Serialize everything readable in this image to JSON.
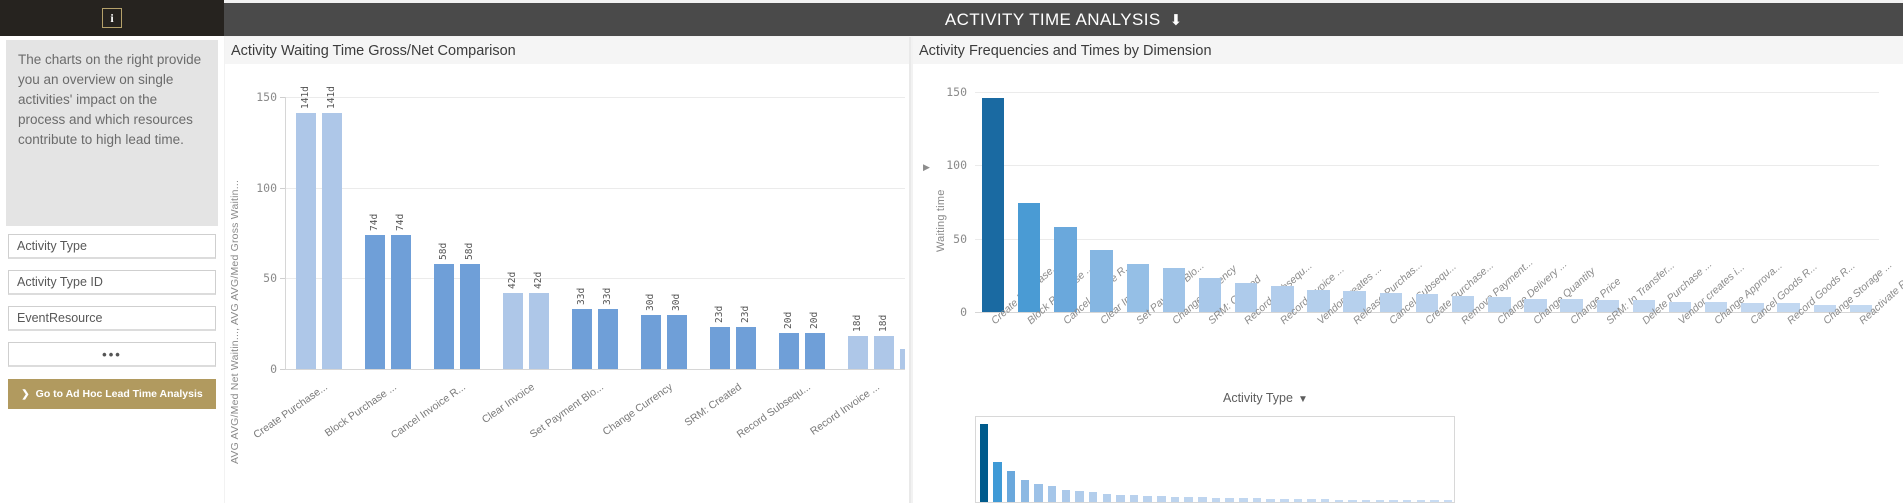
{
  "sidebar": {
    "info_icon": "info-icon",
    "description": "The charts on the right provide you an overview on single activities' impact on the process and which resources contribute to high lead time.",
    "filters": [
      {
        "label": "Activity Type"
      },
      {
        "label": "Activity Type ID"
      },
      {
        "label": "EventResource"
      },
      {
        "label": "•••"
      }
    ],
    "cta": {
      "chevron": "❯",
      "label": "Go to Ad Hoc Lead Time Analysis"
    }
  },
  "header": {
    "title": "ACTIVITY TIME ANALYSIS",
    "arrow_icon": "download-arrow-icon",
    "arrow": "⬇"
  },
  "panels": {
    "left_title": "Activity Waiting Time Gross/Net Comparison",
    "right_title": "Activity Frequencies and Times by Dimension",
    "right_legend": "Activity Type",
    "right_legend_caret": "▼",
    "playhead": "▶"
  },
  "chart_data": [
    {
      "id": "waiting-gross-net",
      "type": "bar",
      "title": "Activity Waiting Time Gross/Net Comparison",
      "ylabel": "AVG AVG/Med Net Waitin..., AVG AVG/Med Gross Waitin...",
      "xlabel": "",
      "ylim": [
        0,
        150
      ],
      "yticks": [
        0,
        50,
        100,
        150
      ],
      "ytick_labels": [
        "0",
        "50",
        "100",
        "150"
      ],
      "grid": true,
      "legend": "none",
      "colors": {
        "net": "#aec7e8",
        "gross": "#6f9fd8"
      },
      "categories": [
        "Create Purchase...",
        "Block Purchase ...",
        "Cancel Invoice R...",
        "Clear Invoice",
        "Set Payment Blo...",
        "Change Currency",
        "SRM: Created",
        "Record Subsequ...",
        "Record Invoice ..."
      ],
      "series": [
        {
          "name": "AVG/Med Net Waiting Time",
          "values": [
            141,
            74,
            58,
            42,
            33,
            30,
            23,
            20,
            18
          ],
          "labels": [
            "141d",
            "74d",
            "58d",
            "42d",
            "33d",
            "30d",
            "23d",
            "20d",
            "18d"
          ]
        },
        {
          "name": "AVG/Med Gross Waiting Time",
          "values": [
            141,
            74,
            58,
            42,
            33,
            30,
            23,
            20,
            18
          ],
          "labels": [
            "141d",
            "74d",
            "58d",
            "42d",
            "33d",
            "30d",
            "23d",
            "20d",
            "18d"
          ]
        }
      ],
      "pair_shade": [
        "light",
        "dark",
        "dark",
        "light",
        "dark",
        "dark",
        "dark",
        "dark",
        "light"
      ]
    },
    {
      "id": "frequencies-times-by-dimension",
      "type": "bar",
      "title": "Activity Frequencies and Times by Dimension",
      "ylabel": "Waiting time",
      "xlabel": "Activity Type",
      "ylim": [
        0,
        150
      ],
      "yticks": [
        0,
        50,
        100,
        150
      ],
      "ytick_labels": [
        "0",
        "50",
        "100",
        "150"
      ],
      "grid": true,
      "categories": [
        "Create Purchase...",
        "Block Purchase ...",
        "Cancel Invoice R...",
        "Clear Invoice",
        "Set Payment Blo...",
        "Change Currency",
        "SRM: Created",
        "Record Subsequ...",
        "Record Invoice ...",
        "Vendor creates ...",
        "Release Purchas...",
        "Cancel Subsequ...",
        "Create Purchase...",
        "Remove Payment...",
        "Change Delivery ...",
        "Change Quantity",
        "Change Price",
        "SRM: In Transfer...",
        "Delete Purchase ...",
        "Vendor creates i...",
        "Change Approva...",
        "Cancel Goods R...",
        "Record Goods R...",
        "Change Storage ...",
        "Reactivate Purc..."
      ],
      "values": [
        146,
        74,
        58,
        42,
        33,
        30,
        23,
        20,
        18,
        15,
        14,
        13,
        12,
        11,
        10,
        9,
        9,
        8,
        8,
        7,
        7,
        6,
        6,
        5,
        5
      ],
      "bar_colors": [
        "#1a6aa2",
        "#4a9bd4",
        "#6aa8dc",
        "#85b6e2",
        "#95bfe6",
        "#a0c4e8",
        "#a8c8ea",
        "#aecbeb",
        "#b2cdec",
        "#b4cfec",
        "#b6d0ed",
        "#b8d1ed",
        "#bad2ee",
        "#bbd3ee",
        "#bcd4ee",
        "#bdd4ef",
        "#bed5ef",
        "#bfd5ef",
        "#c0d6f0",
        "#c0d6f0",
        "#c1d7f0",
        "#c2d7f0",
        "#c2d8f1",
        "#c3d8f1",
        "#c3d9f1"
      ]
    },
    {
      "id": "frequencies-mini-overview",
      "type": "bar",
      "title": "",
      "ylim": [
        0,
        150
      ],
      "values": [
        146,
        74,
        58,
        42,
        33,
        30,
        23,
        20,
        18,
        15,
        14,
        13,
        12,
        11,
        10,
        9,
        9,
        8,
        8,
        7,
        7,
        6,
        6,
        5,
        5,
        5,
        4,
        4,
        4,
        3,
        3,
        3,
        3,
        2,
        2
      ],
      "bar_colors": [
        "#005b8c",
        "#3f9ad6",
        "#6aa8dc",
        "#8cb9e3",
        "#9cc1e7",
        "#a5c6e9",
        "#abc9ea",
        "#b0cceb",
        "#b3ceec",
        "#b5cfec",
        "#b7d0ed",
        "#b9d1ed",
        "#bad2ee",
        "#bcd3ee",
        "#bdd4ee",
        "#bed5ef",
        "#bfd5ef",
        "#c0d6f0",
        "#c0d6f0",
        "#c1d7f0",
        "#c2d7f0",
        "#c2d8f1",
        "#c3d8f1",
        "#c3d9f1",
        "#c4d9f1",
        "#c4d9f1",
        "#c5daf2",
        "#c5daf2",
        "#c6daf2",
        "#c6dbf2",
        "#c7dbf3",
        "#c7dbf3",
        "#c8dcf3",
        "#c8dcf3",
        "#c9dcf4"
      ]
    }
  ]
}
